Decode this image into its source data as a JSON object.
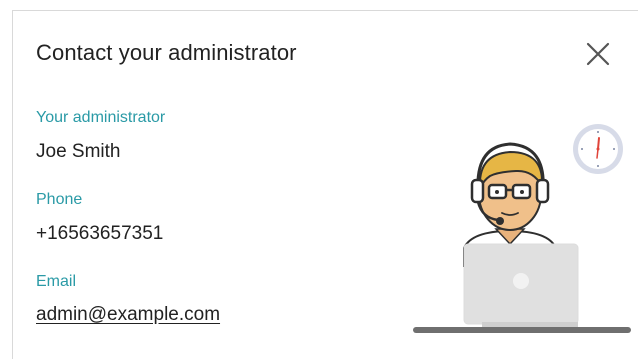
{
  "dialog": {
    "title": "Contact your administrator",
    "close_icon": "close-icon"
  },
  "contact": {
    "admin_label": "Your administrator",
    "admin_name": "Joe Smith",
    "phone_label": "Phone",
    "phone_value": "+16563657351",
    "email_label": "Email",
    "email_value": "admin@example.com"
  },
  "colors": {
    "label_accent": "#2a9aa6",
    "text": "#222222"
  },
  "illustration": {
    "icons": [
      "support-agent-icon",
      "headset-icon",
      "laptop-icon",
      "clock-icon"
    ]
  }
}
